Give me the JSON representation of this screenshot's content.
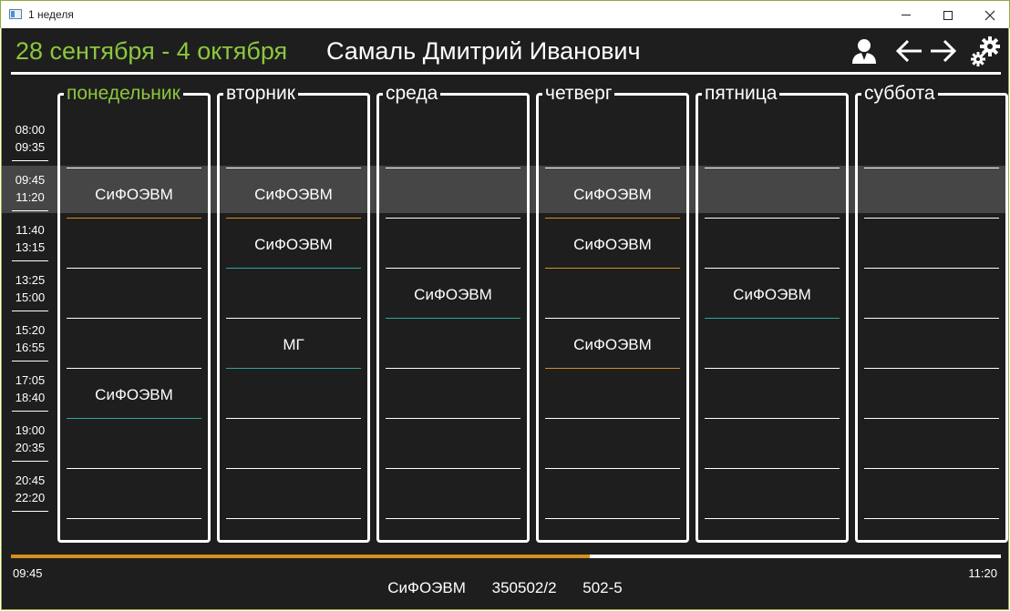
{
  "window": {
    "title": "1 неделя"
  },
  "header": {
    "date_range": "28 сентября - 4 октября",
    "teacher_name": "Самаль Дмитрий Иванович",
    "icons": [
      "user-icon",
      "arrow-left-icon",
      "arrow-right-icon",
      "settings-gears-icon"
    ]
  },
  "time_slots": [
    {
      "start": "08:00",
      "end": "09:35"
    },
    {
      "start": "09:45",
      "end": "11:20"
    },
    {
      "start": "11:40",
      "end": "13:15"
    },
    {
      "start": "13:25",
      "end": "15:00"
    },
    {
      "start": "15:20",
      "end": "16:55"
    },
    {
      "start": "17:05",
      "end": "18:40"
    },
    {
      "start": "19:00",
      "end": "20:35"
    },
    {
      "start": "20:45",
      "end": "22:20"
    }
  ],
  "days": [
    {
      "name": "понедельник",
      "current": true,
      "lessons": [
        {
          "subject": "",
          "accent": ""
        },
        {
          "subject": "СиФОЭВМ",
          "accent": "orange"
        },
        {
          "subject": "",
          "accent": ""
        },
        {
          "subject": "",
          "accent": ""
        },
        {
          "subject": "",
          "accent": ""
        },
        {
          "subject": "СиФОЭВМ",
          "accent": "teal"
        },
        {
          "subject": "",
          "accent": ""
        },
        {
          "subject": "",
          "accent": ""
        }
      ]
    },
    {
      "name": "вторник",
      "current": false,
      "lessons": [
        {
          "subject": "",
          "accent": ""
        },
        {
          "subject": "СиФОЭВМ",
          "accent": "orange"
        },
        {
          "subject": "СиФОЭВМ",
          "accent": "teal"
        },
        {
          "subject": "",
          "accent": ""
        },
        {
          "subject": "МГ",
          "accent": "teal"
        },
        {
          "subject": "",
          "accent": ""
        },
        {
          "subject": "",
          "accent": ""
        },
        {
          "subject": "",
          "accent": ""
        }
      ]
    },
    {
      "name": "среда",
      "current": false,
      "lessons": [
        {
          "subject": "",
          "accent": ""
        },
        {
          "subject": "",
          "accent": ""
        },
        {
          "subject": "",
          "accent": ""
        },
        {
          "subject": "СиФОЭВМ",
          "accent": "teal"
        },
        {
          "subject": "",
          "accent": ""
        },
        {
          "subject": "",
          "accent": ""
        },
        {
          "subject": "",
          "accent": ""
        },
        {
          "subject": "",
          "accent": ""
        }
      ]
    },
    {
      "name": "четверг",
      "current": false,
      "lessons": [
        {
          "subject": "",
          "accent": ""
        },
        {
          "subject": "СиФОЭВМ",
          "accent": "orange"
        },
        {
          "subject": "СиФОЭВМ",
          "accent": "orange"
        },
        {
          "subject": "",
          "accent": ""
        },
        {
          "subject": "СиФОЭВМ",
          "accent": "orange"
        },
        {
          "subject": "",
          "accent": ""
        },
        {
          "subject": "",
          "accent": ""
        },
        {
          "subject": "",
          "accent": ""
        }
      ]
    },
    {
      "name": "пятница",
      "current": false,
      "lessons": [
        {
          "subject": "",
          "accent": ""
        },
        {
          "subject": "",
          "accent": ""
        },
        {
          "subject": "",
          "accent": ""
        },
        {
          "subject": "СиФОЭВМ",
          "accent": "teal"
        },
        {
          "subject": "",
          "accent": ""
        },
        {
          "subject": "",
          "accent": ""
        },
        {
          "subject": "",
          "accent": ""
        },
        {
          "subject": "",
          "accent": ""
        }
      ]
    },
    {
      "name": "суббота",
      "current": false,
      "lessons": [
        {
          "subject": "",
          "accent": ""
        },
        {
          "subject": "",
          "accent": ""
        },
        {
          "subject": "",
          "accent": ""
        },
        {
          "subject": "",
          "accent": ""
        },
        {
          "subject": "",
          "accent": ""
        },
        {
          "subject": "",
          "accent": ""
        },
        {
          "subject": "",
          "accent": ""
        },
        {
          "subject": "",
          "accent": ""
        }
      ]
    }
  ],
  "current_lesson": {
    "start": "09:45",
    "end": "11:20",
    "progress_fraction": 0.585,
    "subject": "СиФОЭВМ",
    "group": "350502/2",
    "room": "502-5"
  },
  "colors": {
    "background": "#1e1e1e",
    "accent_green": "#8cc63f",
    "orange": "#d4901f",
    "teal": "#2aa89a",
    "text": "#ffffff"
  }
}
